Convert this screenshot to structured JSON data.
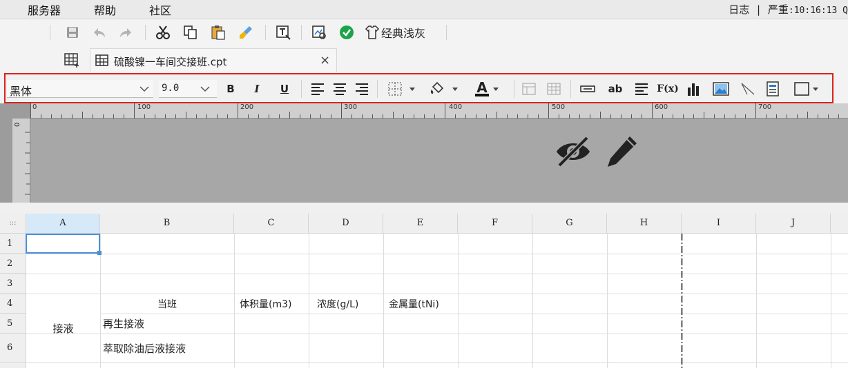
{
  "menubar": {
    "items": [
      "服务器",
      "帮助",
      "社区"
    ],
    "status": {
      "log": "日志",
      "sep": "|",
      "severity": "严重",
      "time": ":10:16:13 Q"
    }
  },
  "toolbar": {
    "theme_label": "经典浅灰"
  },
  "tab": {
    "filename": "硫酸镍一车间交接班.cpt",
    "close": "×"
  },
  "format": {
    "font": "黑体",
    "size": "9.0",
    "bold": "B",
    "italic": "I",
    "underline": "U",
    "font_color_glyph": "A",
    "text_btn": "ab",
    "formula_btn": "F(x)"
  },
  "ruler": {
    "labels": [
      "0",
      "100",
      "200",
      "300",
      "400",
      "500",
      "600",
      "700"
    ],
    "left_label": "0"
  },
  "grid": {
    "corner": ":::",
    "columns": [
      "A",
      "B",
      "C",
      "D",
      "E",
      "F",
      "G",
      "H",
      "I",
      "J"
    ],
    "rows": [
      "1",
      "2",
      "3",
      "4",
      "5",
      "6"
    ],
    "cells": {
      "b4": "当班",
      "c4": "体积量(m3)",
      "d4": "浓度(g/L)",
      "e4": "金属量(tNi)",
      "a5": "接液",
      "b5": "再生接液",
      "b6": "萃取除油后液接液"
    }
  },
  "colors": {
    "accent": "#4a90d9",
    "highlight": "#d9221f",
    "selected_header": "#d6e9f8"
  }
}
